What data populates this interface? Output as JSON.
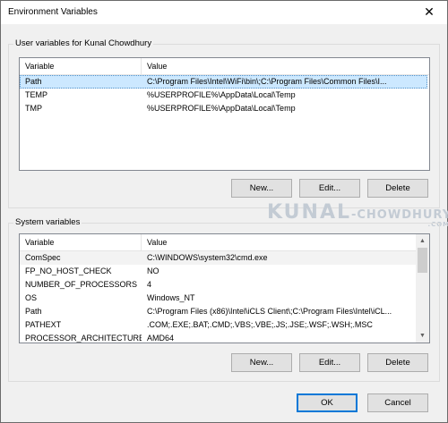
{
  "window": {
    "title": "Environment Variables",
    "close_glyph": "✕"
  },
  "user_vars": {
    "group_label": "User variables for Kunal Chowdhury",
    "columns": [
      "Variable",
      "Value"
    ],
    "rows": [
      {
        "name": "Path",
        "value": "C:\\Program Files\\Intel\\WiFi\\bin\\;C:\\Program Files\\Common Files\\I...",
        "selected": true
      },
      {
        "name": "TEMP",
        "value": "%USERPROFILE%\\AppData\\Local\\Temp",
        "selected": false
      },
      {
        "name": "TMP",
        "value": "%USERPROFILE%\\AppData\\Local\\Temp",
        "selected": false
      }
    ],
    "buttons": {
      "new": "New...",
      "edit": "Edit...",
      "delete": "Delete"
    }
  },
  "system_vars": {
    "group_label": "System variables",
    "columns": [
      "Variable",
      "Value"
    ],
    "rows": [
      {
        "name": "ComSpec",
        "value": "C:\\WINDOWS\\system32\\cmd.exe"
      },
      {
        "name": "FP_NO_HOST_CHECK",
        "value": "NO"
      },
      {
        "name": "NUMBER_OF_PROCESSORS",
        "value": "4"
      },
      {
        "name": "OS",
        "value": "Windows_NT"
      },
      {
        "name": "Path",
        "value": "C:\\Program Files (x86)\\Intel\\iCLS Client\\;C:\\Program Files\\Intel\\iCL..."
      },
      {
        "name": "PATHEXT",
        "value": ".COM;.EXE;.BAT;.CMD;.VBS;.VBE;.JS;.JSE;.WSF;.WSH;.MSC"
      },
      {
        "name": "PROCESSOR_ARCHITECTURE",
        "value": "AMD64"
      }
    ],
    "buttons": {
      "new": "New...",
      "edit": "Edit...",
      "delete": "Delete"
    }
  },
  "watermark": {
    "text_main": "KUNAL",
    "text_second": "CHOWDHURY",
    "dotcom": ".COM"
  },
  "footer": {
    "ok": "OK",
    "cancel": "Cancel"
  },
  "colors": {
    "selection": "#cce8ff",
    "default_button_border": "#0078d7"
  }
}
